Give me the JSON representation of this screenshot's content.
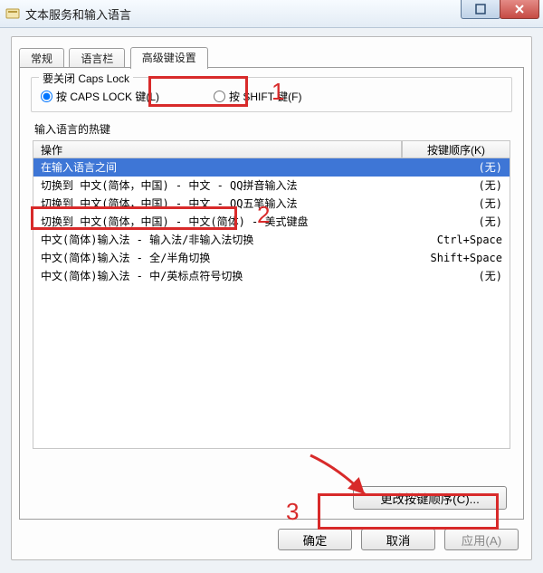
{
  "window": {
    "title": "文本服务和输入语言"
  },
  "tabs": {
    "general": "常规",
    "langbar": "语言栏",
    "advanced": "高级键设置"
  },
  "capslock": {
    "group_title": "要关闭 Caps Lock",
    "opt_caps": "按 CAPS LOCK 键(L)",
    "opt_shift": "按 SHIFT 键(F)"
  },
  "hotkeys": {
    "section": "输入语言的热键",
    "col_action": "操作",
    "col_key": "按键顺序(K)",
    "rows": [
      {
        "action": "在输入语言之间",
        "key": "(无)",
        "selected": true
      },
      {
        "action": "切换到 中文(简体，中国) - 中文 - QQ拼音输入法",
        "key": "(无)"
      },
      {
        "action": "切换到 中文(简体，中国) - 中文 - QQ五笔输入法",
        "key": "(无)"
      },
      {
        "action": "切换到 中文(简体，中国) - 中文(简体) - 美式键盘",
        "key": "(无)"
      },
      {
        "action": "中文(简体)输入法 - 输入法/非输入法切换",
        "key": "Ctrl+Space"
      },
      {
        "action": "中文(简体)输入法 - 全/半角切换",
        "key": "Shift+Space"
      },
      {
        "action": "中文(简体)输入法 - 中/英标点符号切换",
        "key": "(无)"
      }
    ],
    "change_btn": "更改按键顺序(C)..."
  },
  "buttons": {
    "ok": "确定",
    "cancel": "取消",
    "apply": "应用(A)"
  },
  "annotations": {
    "n1": "1",
    "n2": "2",
    "n3": "3"
  }
}
